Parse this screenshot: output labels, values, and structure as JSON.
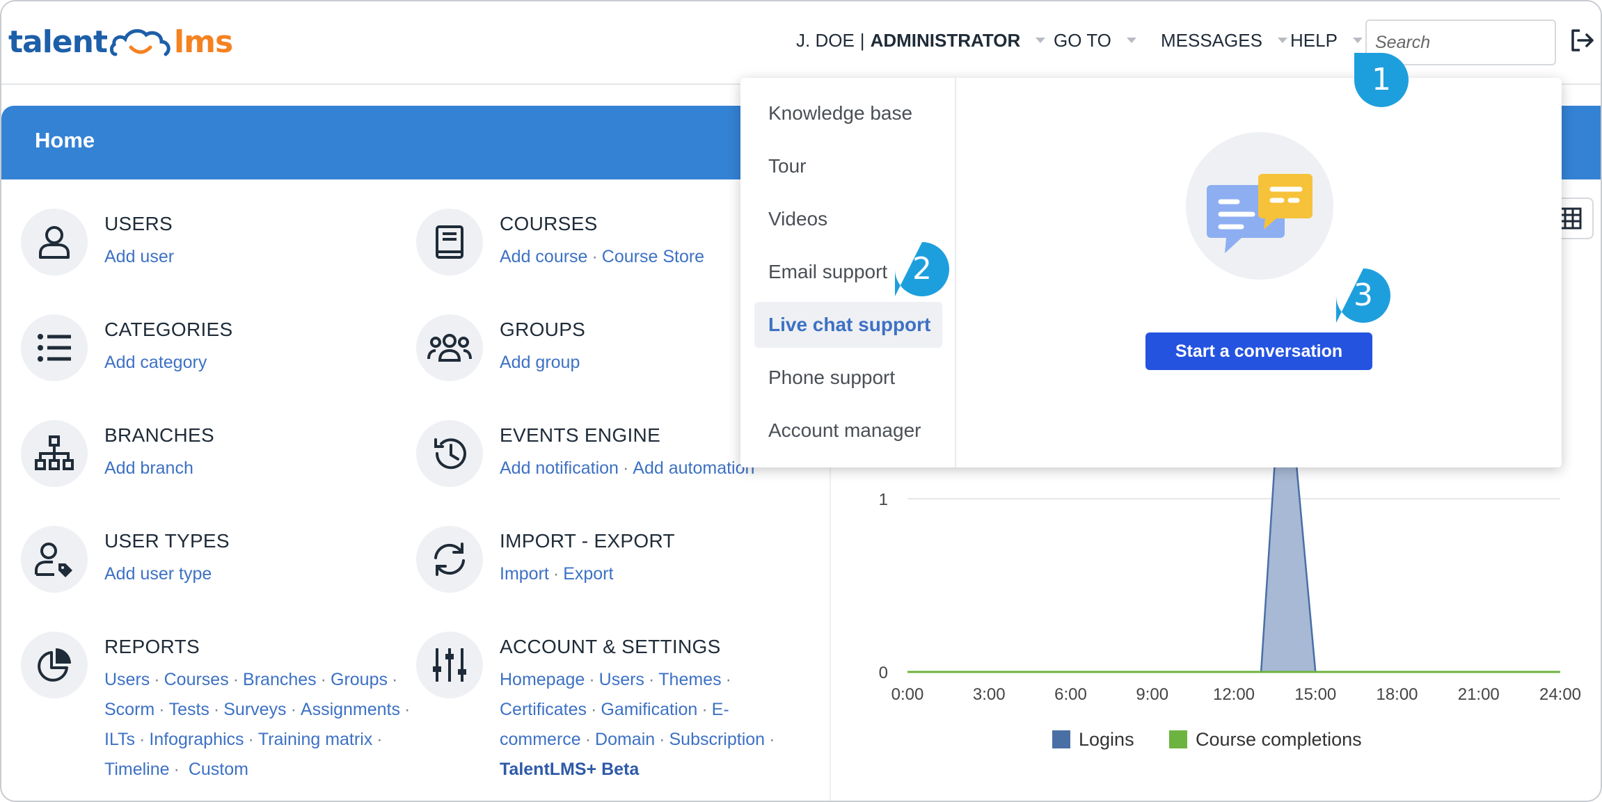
{
  "logo": {
    "left": "talent",
    "right": "lms"
  },
  "topbar": {
    "user_name": "J. DOE",
    "user_sep": "|",
    "user_role": "ADMINISTRATOR",
    "goto": "GO TO",
    "messages": "MESSAGES",
    "help": "HELP",
    "search_placeholder": "Search"
  },
  "home": {
    "title": "Home"
  },
  "tiles": {
    "users": {
      "title": "USERS",
      "links": [
        "Add user"
      ]
    },
    "courses": {
      "title": "COURSES",
      "links": [
        "Add course",
        "Course Store"
      ]
    },
    "categories": {
      "title": "CATEGORIES",
      "links": [
        "Add category"
      ]
    },
    "groups": {
      "title": "GROUPS",
      "links": [
        "Add group"
      ]
    },
    "branches": {
      "title": "BRANCHES",
      "links": [
        "Add branch"
      ]
    },
    "events": {
      "title": "EVENTS ENGINE",
      "links": [
        "Add notification",
        "Add automation"
      ]
    },
    "usertypes": {
      "title": "USER TYPES",
      "links": [
        "Add user type"
      ]
    },
    "importexport": {
      "title": "IMPORT - EXPORT",
      "links": [
        "Import",
        "Export"
      ]
    },
    "reports": {
      "title": "REPORTS",
      "links": [
        "Users",
        "Courses",
        "Branches",
        "Groups",
        "Scorm",
        "Tests",
        "Surveys",
        "Assignments",
        "ILTs",
        "Infographics",
        "Training matrix",
        "Timeline",
        "Custom"
      ]
    },
    "account": {
      "title": "ACCOUNT & SETTINGS",
      "links": [
        "Homepage",
        "Users",
        "Themes",
        "Certificates",
        "Gamification",
        "E-",
        "commerce",
        "Domain",
        "Subscription",
        "TalentLMS+ Beta"
      ]
    }
  },
  "help_menu": {
    "items": [
      "Knowledge base",
      "Tour",
      "Videos",
      "Email support",
      "Live chat support",
      "Phone support",
      "Account manager"
    ],
    "active_item": "Live chat support",
    "cta": "Start a conversation"
  },
  "callouts": [
    "1",
    "2",
    "3"
  ],
  "chart_data": {
    "type": "area",
    "x": [
      "0:00",
      "3:00",
      "6:00",
      "9:00",
      "12:00",
      "15:00",
      "18:00",
      "21:00",
      "24:00"
    ],
    "yticks": [
      "0",
      "1"
    ],
    "ylim": [
      0,
      1
    ],
    "series": [
      {
        "name": "Logins",
        "color": "#4a6fa5",
        "points": [
          [
            0,
            0
          ],
          [
            13,
            0
          ],
          [
            13.5,
            1.2
          ],
          [
            14.3,
            1.2
          ],
          [
            15,
            0
          ],
          [
            24,
            0
          ]
        ]
      },
      {
        "name": "Course completions",
        "color": "#6db33f",
        "points": [
          [
            0,
            0
          ],
          [
            24,
            0
          ]
        ]
      }
    ],
    "legend": "bottom"
  }
}
